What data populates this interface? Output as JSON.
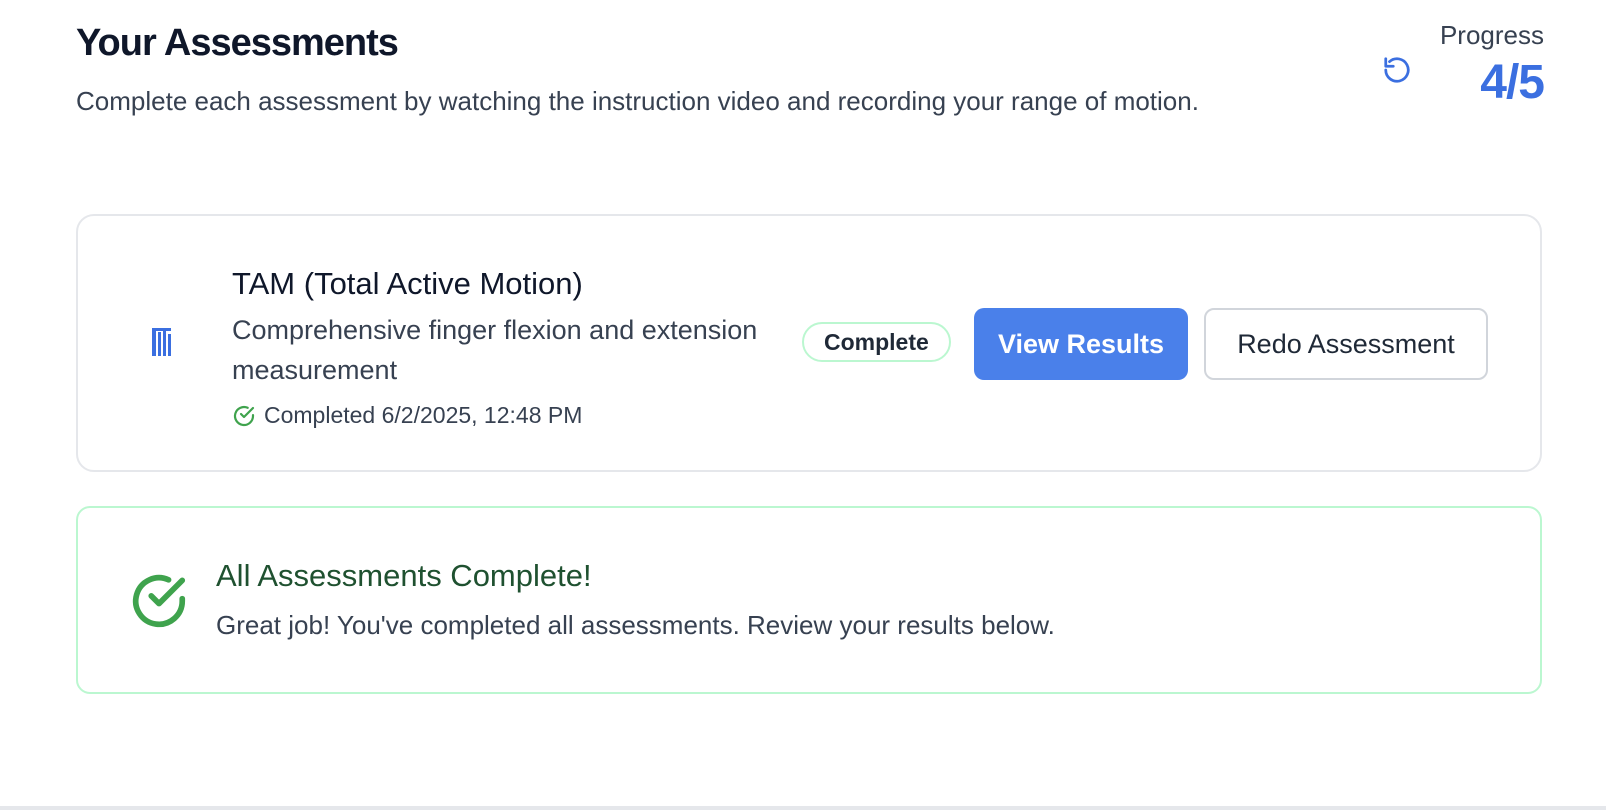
{
  "header": {
    "title": "Your Assessments",
    "subtitle": "Complete each assessment by watching the instruction video and recording your range of motion.",
    "refresh_icon": "refresh-icon",
    "progress_label": "Progress",
    "progress_value": "4/5"
  },
  "assessment": {
    "icon": "hand-bars-icon",
    "title": "TAM (Total Active Motion)",
    "description": "Comprehensive finger flexion and extension measurement",
    "completed_text": "Completed 6/2/2025, 12:48 PM",
    "status": "Complete",
    "view_results_label": "View Results",
    "redo_label": "Redo Assessment"
  },
  "banner": {
    "title": "All Assessments Complete!",
    "text": "Great job! You've completed all assessments. Review your results below."
  },
  "colors": {
    "accent": "#4a80ea",
    "progress": "#3b6fe0",
    "success": "#3fa34d",
    "success_border": "#bbf7d0",
    "success_title": "#1f5130"
  }
}
